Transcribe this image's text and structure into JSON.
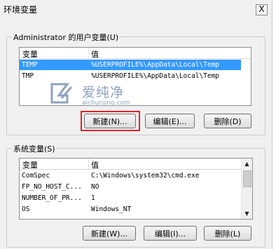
{
  "window": {
    "title": "环境变量",
    "close_glyph": "X"
  },
  "user_vars": {
    "group_label": "Administrator 的用户变量(U)",
    "columns": [
      "变量",
      "值"
    ],
    "rows": [
      {
        "name": "TEMP",
        "value": "%USERPROFILE%\\AppData\\Local\\Temp",
        "selected": true
      },
      {
        "name": "TMP",
        "value": "%USERPROFILE%\\AppData\\Local\\Temp",
        "selected": false
      }
    ],
    "buttons": {
      "new": "新建(N)...",
      "edit": "编辑(E)...",
      "delete": "删除(D)"
    }
  },
  "system_vars": {
    "group_label": "系统变量(S)",
    "columns": [
      "变量",
      "值"
    ],
    "rows": [
      {
        "name": "ComSpec",
        "value": "C:\\Windows\\system32\\cmd.exe"
      },
      {
        "name": "FP_NO_HOST_C...",
        "value": "NO"
      },
      {
        "name": "NUMBER_OF_PR...",
        "value": "1"
      },
      {
        "name": "OS",
        "value": "Windows_NT"
      }
    ],
    "buttons": {
      "new": "新建(W)...",
      "edit": "编辑(I)...",
      "delete": "删除(L)"
    }
  },
  "watermark": {
    "name": "爱纯净",
    "url": "aichunjing.com"
  },
  "colors": {
    "selection": "#3399ff",
    "highlight_border": "#e0242a",
    "dialog_bg": "#f0f0f0"
  },
  "icons": {
    "scroll_up": "up-arrow-icon",
    "scroll_down": "down-arrow-icon",
    "close": "close-icon"
  }
}
